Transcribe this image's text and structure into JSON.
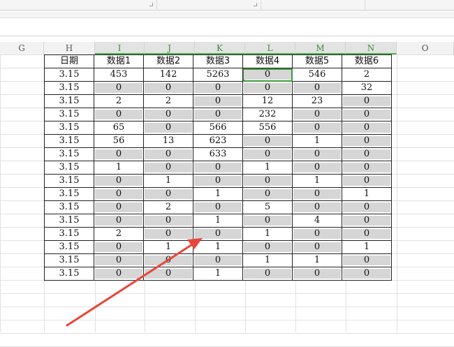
{
  "columns": [
    "G",
    "H",
    "I",
    "J",
    "K",
    "L",
    "M",
    "N",
    "O"
  ],
  "headers": [
    "日期",
    "数据1",
    "数据2",
    "数据3",
    "数据4",
    "数据5",
    "数据6"
  ],
  "rows": [
    {
      "date": "3.15",
      "values": [
        "453",
        "142",
        "5263",
        "0",
        "546",
        "2"
      ]
    },
    {
      "date": "3.15",
      "values": [
        "0",
        "0",
        "0",
        "0",
        "0",
        "32"
      ]
    },
    {
      "date": "3.15",
      "values": [
        "2",
        "2",
        "0",
        "12",
        "23",
        "0"
      ]
    },
    {
      "date": "3.15",
      "values": [
        "0",
        "0",
        "0",
        "232",
        "0",
        "0"
      ]
    },
    {
      "date": "3.15",
      "values": [
        "65",
        "0",
        "566",
        "556",
        "0",
        "0"
      ]
    },
    {
      "date": "3.15",
      "values": [
        "56",
        "13",
        "623",
        "0",
        "1",
        "0"
      ]
    },
    {
      "date": "3.15",
      "values": [
        "0",
        "0",
        "633",
        "0",
        "0",
        "0"
      ]
    },
    {
      "date": "3.15",
      "values": [
        "1",
        "0",
        "0",
        "1",
        "0",
        "0"
      ]
    },
    {
      "date": "3.15",
      "values": [
        "0",
        "1",
        "0",
        "0",
        "1",
        "0"
      ]
    },
    {
      "date": "3.15",
      "values": [
        "0",
        "0",
        "1",
        "0",
        "0",
        "1"
      ]
    },
    {
      "date": "3.15",
      "values": [
        "0",
        "2",
        "0",
        "5",
        "0",
        "0"
      ]
    },
    {
      "date": "3.15",
      "values": [
        "0",
        "0",
        "1",
        "0",
        "4",
        "0"
      ]
    },
    {
      "date": "3.15",
      "values": [
        "2",
        "0",
        "0",
        "1",
        "0",
        "0"
      ]
    },
    {
      "date": "3.15",
      "values": [
        "0",
        "1",
        "1",
        "0",
        "0",
        "1"
      ]
    },
    {
      "date": "3.15",
      "values": [
        "0",
        "0",
        "0",
        "1",
        "1",
        "0"
      ]
    },
    {
      "date": "3.15",
      "values": [
        "0",
        "0",
        "1",
        "0",
        "0",
        "0"
      ]
    }
  ],
  "colors": {
    "zero_fill": "#d6d6d6",
    "selected_header": "#3a8e3a",
    "annotation_arrow": "#e8463a"
  }
}
